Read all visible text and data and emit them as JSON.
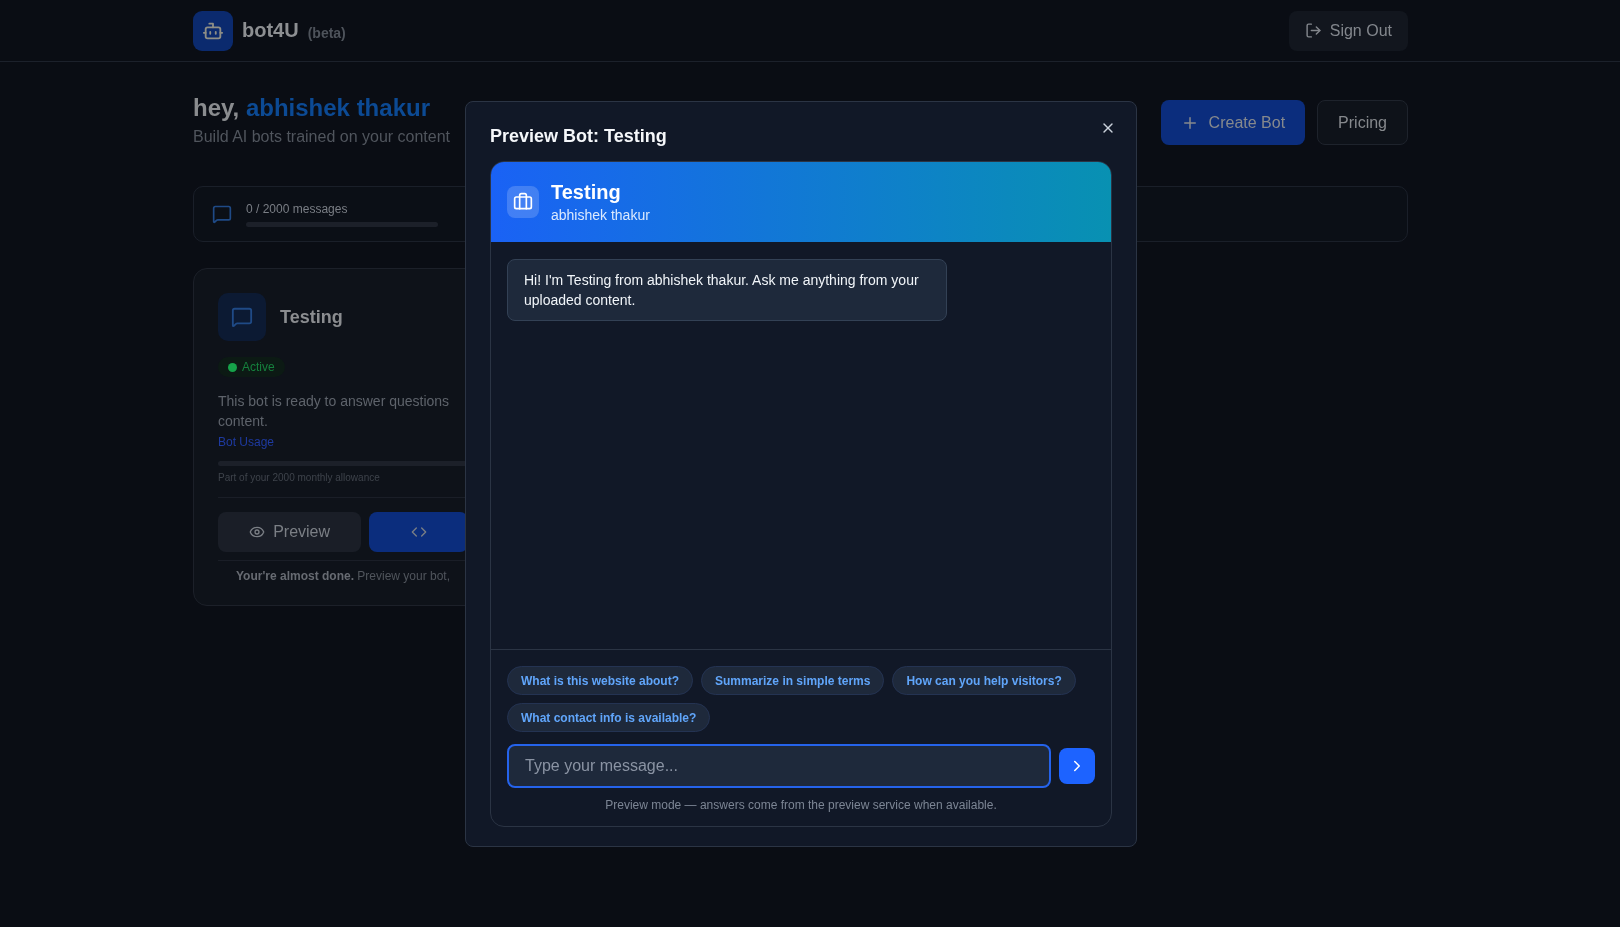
{
  "header": {
    "brand": "bot4U",
    "brand_tag": "(beta)",
    "sign_out": "Sign Out"
  },
  "greeting": {
    "prefix": "hey,",
    "name": "abhishek thakur",
    "subtitle": "Build AI bots trained on your content"
  },
  "actions": [
    {
      "label": "Create Bot",
      "kind": "primary"
    },
    {
      "label": "Pricing",
      "kind": "secondary"
    }
  ],
  "usage": {
    "label": "0 / 2000 messages"
  },
  "bot_card": {
    "name": "Testing",
    "status": "Active",
    "description_lines": [
      "This bot is ready to answer questions",
      "content."
    ],
    "usage_label": "Bot Usage",
    "usage_note": "Part of your 2000 monthly allowance",
    "preview_button": "Preview",
    "footer": "**Your're almost done.** Preview your bot,"
  },
  "modal": {
    "title": "Preview Bot: Testing",
    "chat": {
      "name": "Testing",
      "owner": "abhishek thakur",
      "messages": [
        {
          "text": "Hi! I'm Testing from abhishek thakur. Ask me anything from your uploaded content."
        }
      ],
      "suggestions": [
        "What is this website about?",
        "Summarize in simple terms",
        "How can you help visitors?",
        "What contact info is available?"
      ],
      "input": {
        "placeholder": "Type your message..."
      },
      "note": "Preview mode — answers come from the preview service when available."
    }
  }
}
